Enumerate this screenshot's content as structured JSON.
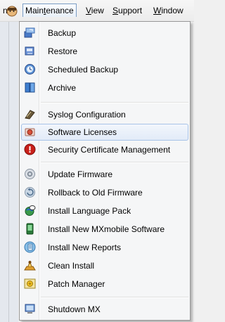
{
  "menubar": {
    "items": [
      {
        "label": "nt"
      },
      {
        "label": "Maintenance",
        "active": true
      },
      {
        "label": "View"
      },
      {
        "label": "Support"
      },
      {
        "label": "Window"
      }
    ]
  },
  "menu": {
    "items": [
      {
        "label": "Backup",
        "icon": "backup-icon"
      },
      {
        "label": "Restore",
        "icon": "restore-icon"
      },
      {
        "label": "Scheduled Backup",
        "icon": "scheduled-backup-icon"
      },
      {
        "label": "Archive",
        "icon": "archive-icon"
      },
      {
        "label": "Syslog Configuration",
        "icon": "syslog-icon"
      },
      {
        "label": "Software Licenses",
        "icon": "license-icon",
        "highlighted": true
      },
      {
        "label": "Security Certificate Management",
        "icon": "certificate-icon"
      },
      {
        "label": "Update Firmware",
        "icon": "update-firmware-icon"
      },
      {
        "label": "Rollback to Old Firmware",
        "icon": "rollback-icon"
      },
      {
        "label": "Install Language Pack",
        "icon": "language-pack-icon"
      },
      {
        "label": "Install New MXmobile Software",
        "icon": "mobile-icon"
      },
      {
        "label": "Install New Reports",
        "icon": "reports-icon"
      },
      {
        "label": "Clean Install",
        "icon": "clean-install-icon"
      },
      {
        "label": "Patch Manager",
        "icon": "patch-manager-icon"
      },
      {
        "label": "Shutdown MX",
        "icon": "shutdown-icon"
      }
    ]
  }
}
